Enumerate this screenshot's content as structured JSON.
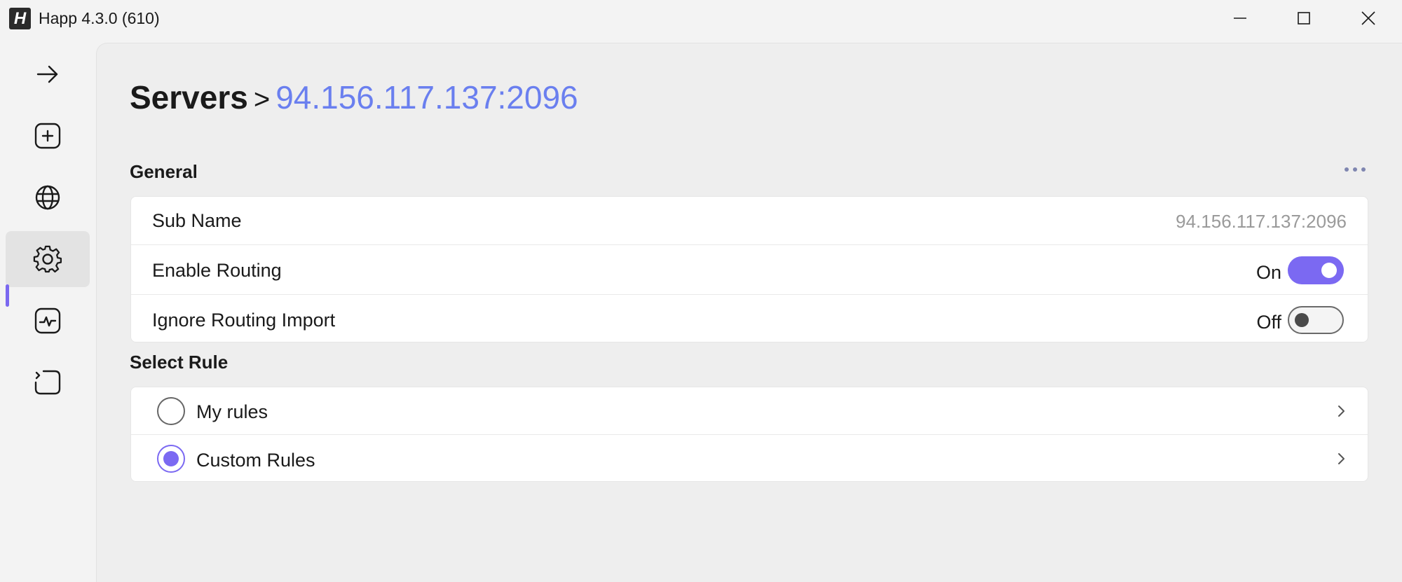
{
  "window": {
    "title": "Happ 4.3.0 (610)",
    "logo_letter": "H",
    "controls": [
      "minimize",
      "maximize",
      "close"
    ]
  },
  "sidebar": {
    "items": [
      {
        "icon": "arrow-right-icon",
        "active": false
      },
      {
        "icon": "plus-square-icon",
        "active": false
      },
      {
        "icon": "globe-icon",
        "active": false
      },
      {
        "icon": "gear-icon",
        "active": true
      },
      {
        "icon": "activity-monitor-icon",
        "active": false
      },
      {
        "icon": "code-box-icon",
        "active": false
      }
    ]
  },
  "breadcrumb": {
    "root": "Servers",
    "separator": ">",
    "current": "94.156.117.137:2096"
  },
  "general": {
    "title": "General",
    "sub_name_label": "Sub Name",
    "sub_name_value": "94.156.117.137:2096",
    "enable_routing_label": "Enable Routing",
    "enable_routing_state": "On",
    "enable_routing_on": true,
    "ignore_routing_label": "Ignore Routing Import",
    "ignore_routing_state": "Off",
    "ignore_routing_on": false
  },
  "select_rule": {
    "title": "Select Rule",
    "options": [
      {
        "label": "My rules",
        "selected": false
      },
      {
        "label": "Custom Rules",
        "selected": true
      }
    ]
  },
  "colors": {
    "accent": "#7b69f2",
    "link": "#6a7fef",
    "background": "#eeeeee"
  }
}
